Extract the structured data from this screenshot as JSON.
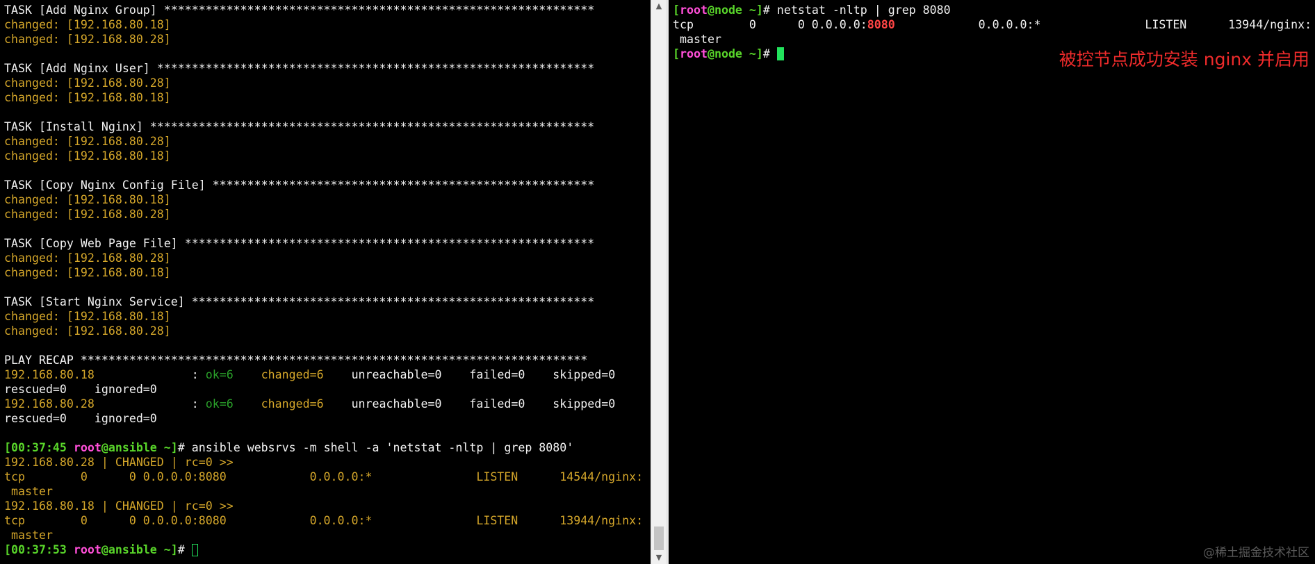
{
  "left_terminal": {
    "tasks": [
      {
        "header": "TASK [Add Nginx Group] ",
        "stars": "**************************************************************",
        "changed": [
          "changed: [192.168.80.18]",
          "changed: [192.168.80.28]"
        ]
      },
      {
        "header": "TASK [Add Nginx User] ",
        "stars": "***************************************************************",
        "changed": [
          "changed: [192.168.80.28]",
          "changed: [192.168.80.18]"
        ]
      },
      {
        "header": "TASK [Install Nginx] ",
        "stars": "****************************************************************",
        "changed": [
          "changed: [192.168.80.28]",
          "changed: [192.168.80.18]"
        ]
      },
      {
        "header": "TASK [Copy Nginx Config File] ",
        "stars": "*******************************************************",
        "changed": [
          "changed: [192.168.80.18]",
          "changed: [192.168.80.28]"
        ]
      },
      {
        "header": "TASK [Copy Web Page File] ",
        "stars": "***********************************************************",
        "changed": [
          "changed: [192.168.80.28]",
          "changed: [192.168.80.18]"
        ]
      },
      {
        "header": "TASK [Start Nginx Service] ",
        "stars": "**********************************************************",
        "changed": [
          "changed: [192.168.80.18]",
          "changed: [192.168.80.28]"
        ]
      }
    ],
    "recap_header": "PLAY RECAP ",
    "recap_stars": "*************************************************************************",
    "recap": [
      {
        "host": "192.168.80.18",
        "sep": "              : ",
        "ok": "ok=6",
        "changed": "changed=6",
        "rest": "unreachable=0    failed=0    skipped=0",
        "rest2": "rescued=0    ignored=0"
      },
      {
        "host": "192.168.80.28",
        "sep": "              : ",
        "ok": "ok=6",
        "changed": "changed=6",
        "rest": "unreachable=0    failed=0    skipped=0",
        "rest2": "rescued=0    ignored=0"
      }
    ],
    "prompt1": {
      "time": "[00:37:45 ",
      "user": "root",
      "host": "@ansible",
      "tail": " ~]",
      "hash": "# ",
      "command": "ansible websrvs -m shell -a 'netstat -nltp | grep 8080'"
    },
    "output": [
      "192.168.80.28 | CHANGED | rc=0 >>",
      "tcp        0      0 0.0.0.0:8080            0.0.0.0:*               LISTEN      14544/nginx:",
      " master",
      "192.168.80.18 | CHANGED | rc=0 >>",
      "tcp        0      0 0.0.0.0:8080            0.0.0.0:*               LISTEN      13944/nginx:",
      " master"
    ],
    "prompt2": {
      "time": "[00:37:53 ",
      "user": "root",
      "host": "@ansible",
      "tail": " ~]",
      "hash": "# "
    }
  },
  "right_terminal": {
    "prompt1": {
      "open": "[",
      "user": "root",
      "host": "@node",
      "tail": " ~]",
      "hash": "# ",
      "command": "netstat -nltp | grep 8080"
    },
    "line2_a": "tcp        0      0 0.0.0.0:",
    "line2_port": "8080",
    "line2_b": "            0.0.0.0:*               LISTEN      13944/nginx:",
    "line3": " master",
    "prompt2": {
      "open": "[",
      "user": "root",
      "host": "@node",
      "tail": " ~]",
      "hash": "# "
    }
  },
  "annotation": "被控节点成功安装 nginx 并启用",
  "watermark": "@稀土掘金技术社区",
  "scrollbar": {
    "up": "▲",
    "down": "▼"
  },
  "colors": {
    "changed": "#d4a62a",
    "ok": "#2aa12a",
    "prompt_green": "#59d62a",
    "prompt_magenta": "#ff4fd8",
    "highlight_red": "#ff4545",
    "annotation_red": "#ee2b2b"
  }
}
